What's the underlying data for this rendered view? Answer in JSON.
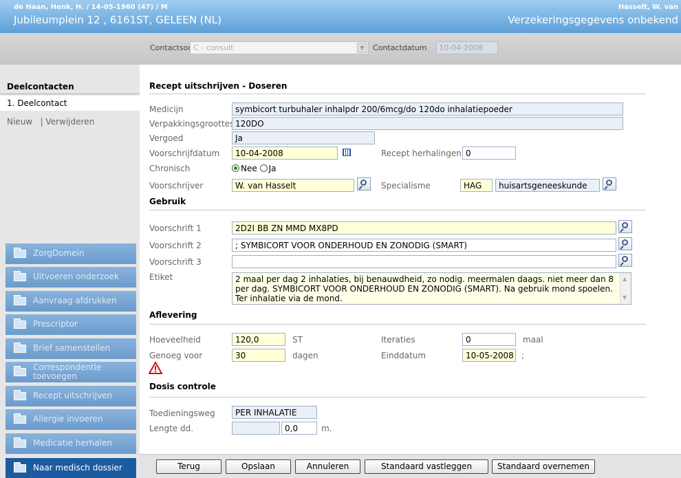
{
  "header": {
    "patient_line": "de Haan, Henk, H. / 14-05-1960 (47) / M",
    "address": "Jubileumplein 12 , 6161ST, GELEEN (NL)",
    "doctor": "Hasselt, W. van",
    "insurance": "Verzekeringsgegevens onbekend"
  },
  "contact": {
    "soort_label": "Contactsoort",
    "soort_value": "C - consult",
    "datum_label": "Contactdatum",
    "datum_value": "10-04-2008"
  },
  "sidebar": {
    "title": "Deelcontacten",
    "selected": "1. Deelcontact",
    "new_link": "Nieuw",
    "delete_link": "| Verwijderen",
    "nav": [
      "ZorgDomein",
      "Uitvoeren onderzoek",
      "Aanvraag afdrukken",
      "Prescriptor",
      "Brief samenstellen",
      "Correspondentie toevoegen",
      "Recept uitschrijven",
      "Allergie invoeren",
      "Medicatie herhalen"
    ],
    "bottom_nav": "Naar medisch dossier"
  },
  "form": {
    "title": "Recept uitschrijven - Doseren",
    "medicijn_label": "Medicijn",
    "medicijn": "symbicort turbuhaler inhalpdr 200/6mcg/do 120do inhalatiepoeder",
    "verpakking_label": "Verpakkingsgroottes",
    "verpakking": "120DO",
    "vergoed_label": "Vergoed",
    "vergoed": "Ja",
    "voorschrijfdatum_label": "Voorschrijfdatum",
    "voorschrijfdatum": "10-04-2008",
    "herhalingen_label": "Recept herhalingen",
    "herhalingen": "0",
    "chronisch_label": "Chronisch",
    "chronisch_nee": "Nee",
    "chronisch_ja": "Ja",
    "voorschrijver_label": "Voorschrijver",
    "voorschrijver": "W. van Hasselt",
    "specialisme_label": "Specialisme",
    "specialisme_code": "HAG",
    "specialisme_name": "huisartsgeneeskunde",
    "gebruik_title": "Gebruik",
    "vs1_label": "Voorschrift 1",
    "vs1": "2D2I BB ZN MMD MX8PD",
    "vs2_label": "Voorschrift 2",
    "vs2": "; SYMBICORT VOOR ONDERHOUD EN ZONODIG (SMART)",
    "vs3_label": "Voorschrift 3",
    "vs3": "",
    "etiket_label": "Etiket",
    "etiket": "2 maal per dag 2 inhalaties, bij benauwdheid, zo nodig. meermalen daags. niet meer dan 8 per dag. SYMBICORT VOOR ONDERHOUD EN ZONODIG (SMART). Na gebruik mond spoelen. Ter inhalatie via de mond.",
    "aflevering_title": "Aflevering",
    "hoeveelheid_label": "Hoeveelheid",
    "hoeveelheid": "120,0",
    "hoeveelheid_unit": "ST",
    "iteraties_label": "Iteraties",
    "iteraties": "0",
    "iteraties_unit": "maal",
    "genoeg_label": "Genoeg voor",
    "genoeg": "30",
    "genoeg_unit": "dagen",
    "einddatum_label": "Einddatum",
    "einddatum": "10-05-2008",
    "einddatum_suffix": ";",
    "dosis_title": "Dosis controle",
    "toediening_label": "Toedieningsweg",
    "toediening": "PER INHALATIE",
    "lengte_label": "Lengte dd.",
    "lengte": "0,0",
    "lengte_unit": "m."
  },
  "buttons": {
    "terug": "Terug",
    "opslaan": "Opslaan",
    "annuleren": "Annuleren",
    "std_vastleggen": "Standaard vastleggen",
    "std_overnemen": "Standaard overnemen"
  },
  "colors": {
    "header_blue": "#5d9fd9",
    "nav_blue": "#6b9bcc",
    "nav_dark": "#1c5ba0",
    "field_yellow": "#ffffd8",
    "field_readonly": "#eaf0f8"
  }
}
